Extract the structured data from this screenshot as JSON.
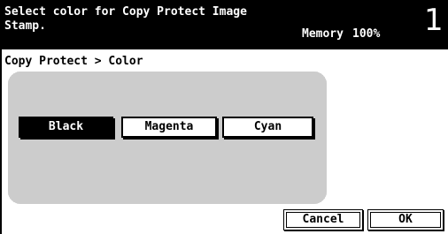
{
  "header": {
    "message_line1": "Select color for Copy Protect Image",
    "message_line2": "Stamp.",
    "memory_label": "Memory",
    "memory_value": "100%",
    "copy_count": "1"
  },
  "breadcrumb": "Copy Protect > Color",
  "color_options": [
    {
      "label": "Black",
      "selected": true
    },
    {
      "label": "Magenta",
      "selected": false
    },
    {
      "label": "Cyan",
      "selected": false
    }
  ],
  "footer": {
    "cancel_label": "Cancel",
    "ok_label": "OK"
  }
}
